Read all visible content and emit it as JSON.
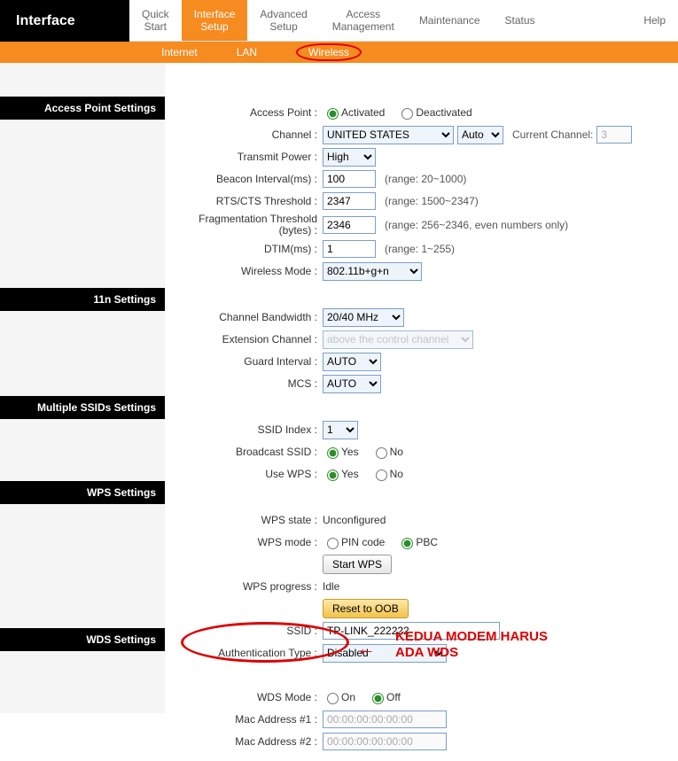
{
  "header": {
    "logo": "Interface",
    "nav": [
      {
        "l1": "Quick",
        "l2": "Start",
        "active": false
      },
      {
        "l1": "Interface",
        "l2": "Setup",
        "active": true
      },
      {
        "l1": "Advanced",
        "l2": "Setup",
        "active": false
      },
      {
        "l1": "Access",
        "l2": "Management",
        "active": false
      },
      {
        "l1": "Maintenance",
        "l2": "",
        "active": false
      },
      {
        "l1": "Status",
        "l2": "",
        "active": false
      },
      {
        "l1": "Help",
        "l2": "",
        "active": false
      }
    ],
    "subnav": {
      "internet": "Internet",
      "lan": "LAN",
      "wireless": "Wireless"
    }
  },
  "sections": {
    "ap": "Access Point Settings",
    "n11": "11n Settings",
    "mss": "Multiple SSIDs Settings",
    "wps": "WPS Settings",
    "wds": "WDS Settings"
  },
  "ap": {
    "access_point_label": "Access Point :",
    "activated": "Activated",
    "deactivated": "Deactivated",
    "channel_label": "Channel :",
    "channel_country": "UNITED STATES",
    "channel_auto": "Auto",
    "cur_ch_label": "Current Channel:",
    "cur_ch": "3",
    "tx_power_label": "Transmit Power :",
    "tx_power": "High",
    "beacon_label": "Beacon Interval(ms) :",
    "beacon": "100",
    "beacon_note": "(range: 20~1000)",
    "rts_label": "RTS/CTS Threshold :",
    "rts": "2347",
    "rts_note": "(range: 1500~2347)",
    "frag_label": "Fragmentation Threshold (bytes) :",
    "frag": "2346",
    "frag_note": "(range: 256~2346, even numbers only)",
    "dtim_label": "DTIM(ms) :",
    "dtim": "1",
    "dtim_note": "(range: 1~255)",
    "wmode_label": "Wireless Mode :",
    "wmode": "802.11b+g+n"
  },
  "n11": {
    "bw_label": "Channel Bandwidth :",
    "bw": "20/40 MHz",
    "ext_label": "Extension Channel :",
    "ext": "above the control channel",
    "gi_label": "Guard Interval :",
    "gi": "AUTO",
    "mcs_label": "MCS :",
    "mcs": "AUTO"
  },
  "mss": {
    "idx_label": "SSID Index :",
    "idx": "1",
    "bssid_label": "Broadcast SSID :",
    "yes": "Yes",
    "no": "No",
    "wps_label": "Use WPS :"
  },
  "wps": {
    "state_label": "WPS state :",
    "state": "Unconfigured",
    "mode_label": "WPS mode :",
    "pin": "PIN code",
    "pbc": "PBC",
    "start_btn": "Start WPS",
    "prog_label": "WPS progress :",
    "prog": "Idle",
    "reset_btn": "Reset to OOB",
    "ssid_label": "SSID :",
    "ssid": "TP-LINK_222222",
    "auth_label": "Authentication Type :",
    "auth": "Disabled"
  },
  "wds": {
    "mode_label": "WDS Mode :",
    "on": "On",
    "off": "Off",
    "mac1_label": "Mac Address #1 :",
    "mac1": "00:00:00:00:00:00",
    "mac2_label": "Mac Address #2 :",
    "mac2": "00:00:00:00:00:00"
  },
  "annotation": {
    "text1": "KEDUA MODEM HARUS",
    "text2": "ADA WDS"
  }
}
